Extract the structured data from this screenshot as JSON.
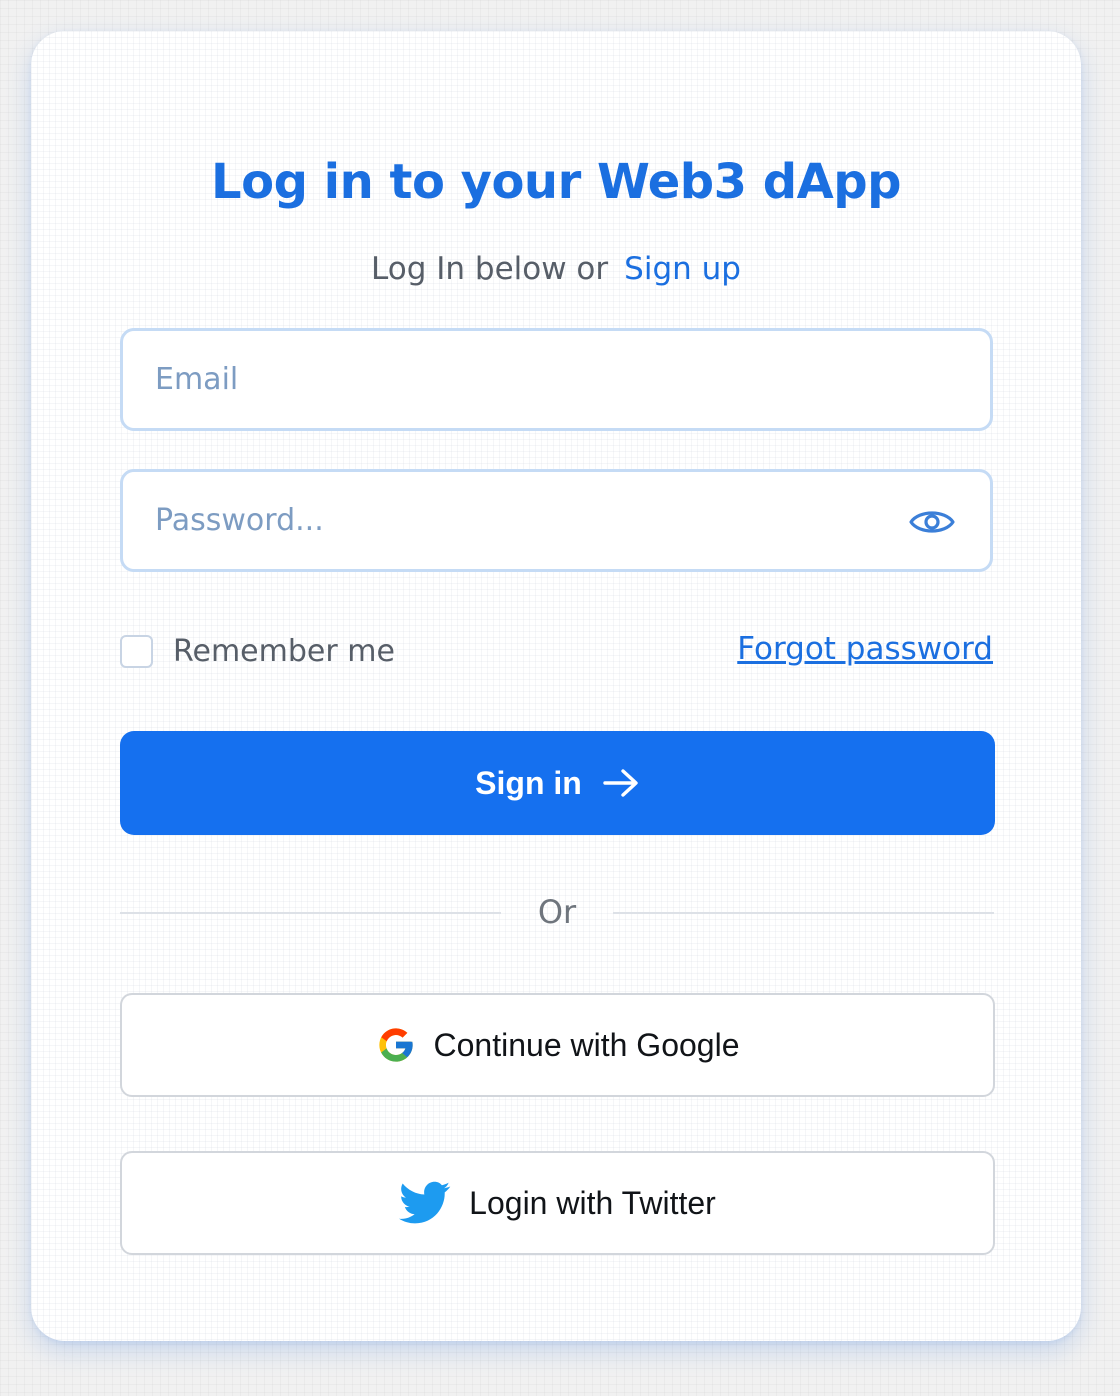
{
  "login": {
    "title": "Log in to your Web3 dApp",
    "subtitle_text": "Log In below or",
    "signup_link": "Sign up",
    "email_placeholder": "Email",
    "password_placeholder": "Password...",
    "remember_label": "Remember me",
    "forgot_link": "Forgot password",
    "signin_label": "Sign in",
    "divider_text": "Or",
    "google_label": "Continue with Google",
    "twitter_label": "Login with Twitter"
  },
  "icons": {
    "password_toggle": "eye-icon",
    "signin": "arrow-right-icon",
    "google": "google-icon",
    "twitter": "twitter-icon"
  },
  "colors": {
    "accent": "#1b6fe0",
    "button": "#1570ef",
    "twitter": "#1d9bf0"
  }
}
